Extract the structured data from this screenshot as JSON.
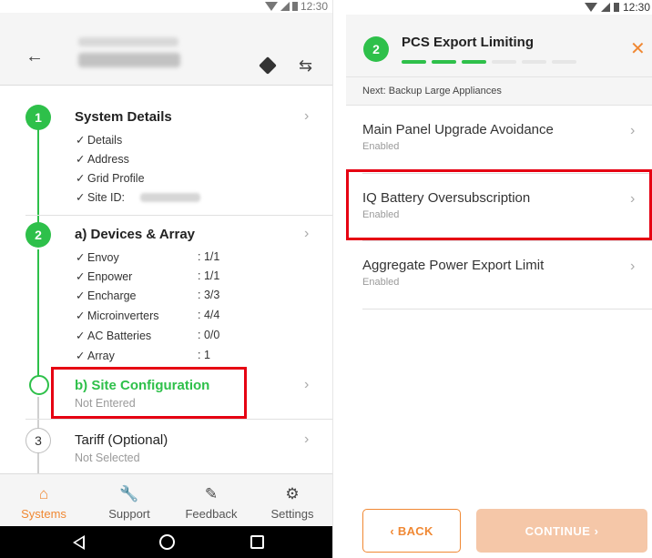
{
  "left": {
    "statusbar": {
      "time": "12:30"
    },
    "header": {
      "back_icon": "back-arrow-icon",
      "nav_icon": "navigation-icon",
      "swap_icon": "swap-icon"
    },
    "steps": [
      {
        "num": "1",
        "title": "System Details",
        "checks": [
          "Details",
          "Address",
          "Grid Profile",
          "Site ID:"
        ]
      },
      {
        "num": "2",
        "title": "a) Devices & Array",
        "checks": [
          {
            "label": "Envoy",
            "value": ": 1/1"
          },
          {
            "label": "Enpower",
            "value": ": 1/1"
          },
          {
            "label": "Encharge",
            "value": ": 3/3"
          },
          {
            "label": "Microinverters",
            "value": ": 4/4"
          },
          {
            "label": "AC Batteries",
            "value": ": 0/0"
          },
          {
            "label": "Array",
            "value": ": 1"
          }
        ]
      },
      {
        "title": "b) Site Configuration",
        "status": "Not Entered",
        "highlight_color": "#e60012"
      },
      {
        "num": "3",
        "title": "Tariff (Optional)",
        "status": "Not Selected"
      }
    ],
    "check_mark": "✓",
    "bottom_nav": [
      {
        "label": "Systems",
        "icon": "home-icon",
        "active": true
      },
      {
        "label": "Support",
        "icon": "wrench-icon",
        "active": false
      },
      {
        "label": "Feedback",
        "icon": "feedback-icon",
        "active": false
      },
      {
        "label": "Settings",
        "icon": "gear-icon",
        "active": false
      }
    ]
  },
  "right": {
    "statusbar": {
      "time": "12:30"
    },
    "header": {
      "step_num": "2",
      "title": "PCS Export Limiting",
      "close": "✕",
      "progress_total": 6,
      "progress_done": 3
    },
    "next_text": "Next: Backup Large Appliances",
    "options": [
      {
        "title": "Main Panel Upgrade Avoidance",
        "status": "Enabled"
      },
      {
        "title": "IQ Battery Oversubscription",
        "status": "Enabled",
        "highlighted": true
      },
      {
        "title": "Aggregate Power Export Limit",
        "status": "Enabled"
      }
    ],
    "buttons": {
      "back": "‹  BACK",
      "continue": "CONTINUE  ›"
    }
  },
  "colors": {
    "accent": "#f08833",
    "success": "#2ec04a",
    "highlight": "#e60012",
    "continue_disabled": "#f5c7a8"
  }
}
